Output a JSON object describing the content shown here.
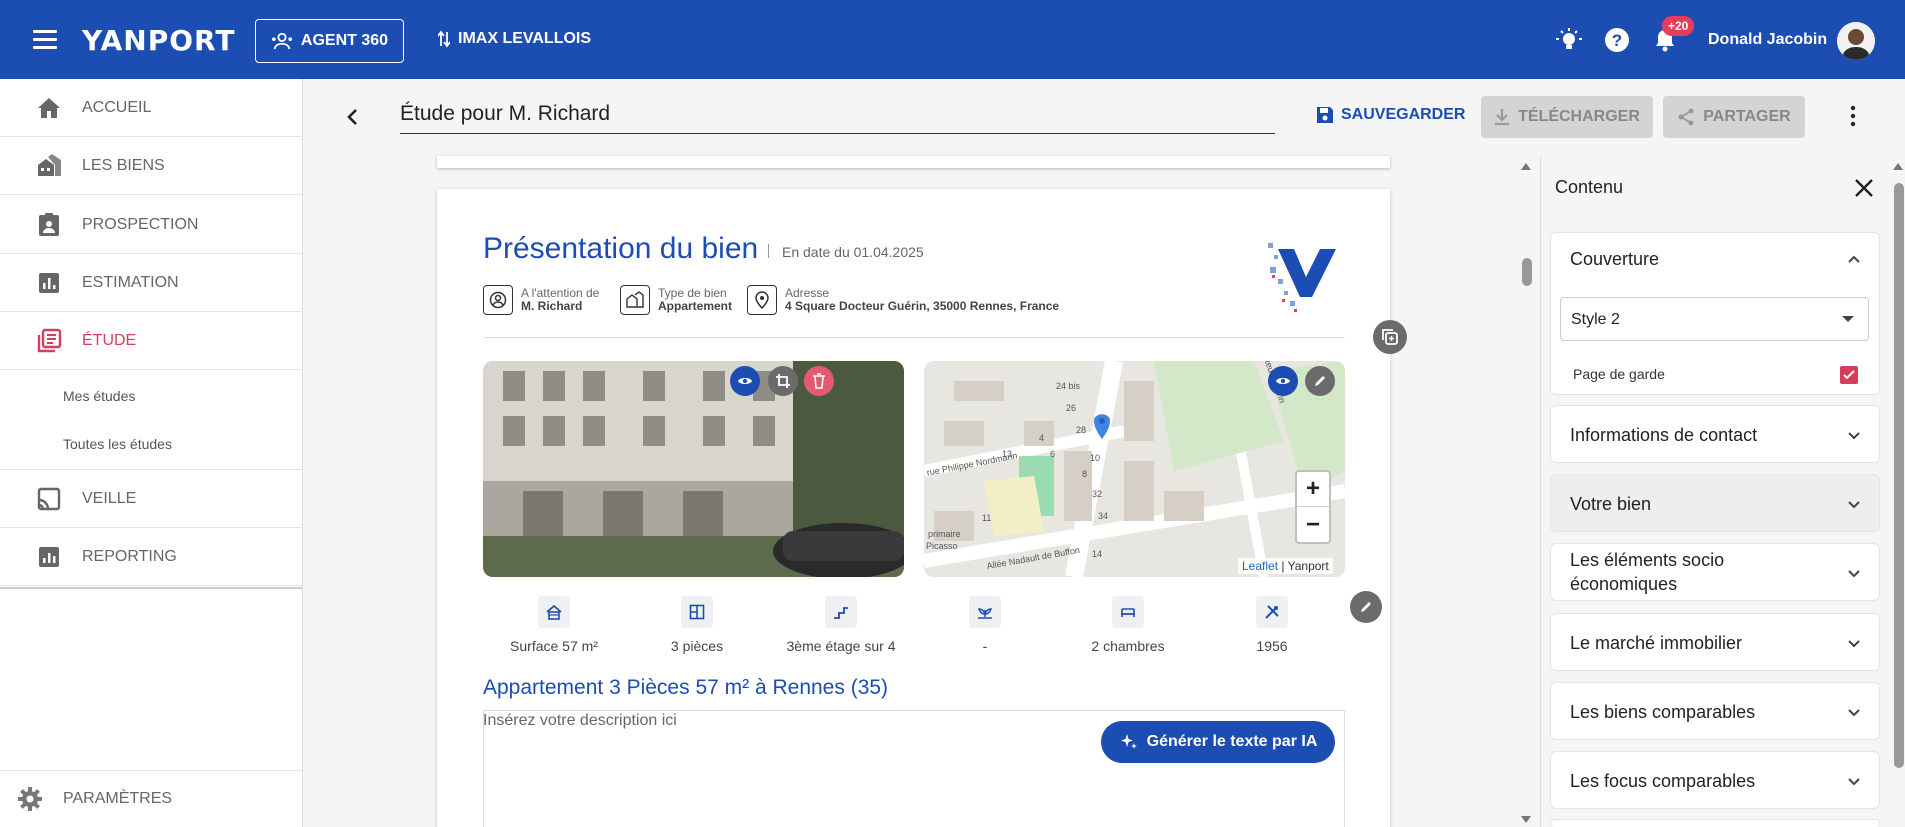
{
  "header": {
    "logo": "YANPORT",
    "agent_button": "AGENT 360",
    "agency": "IMAX LEVALLOIS",
    "notifications_badge": "+20",
    "username": "Donald Jacobin"
  },
  "sidebar": {
    "items": [
      {
        "label": "ACCUEIL"
      },
      {
        "label": "LES BIENS"
      },
      {
        "label": "PROSPECTION"
      },
      {
        "label": "ESTIMATION"
      },
      {
        "label": "ÉTUDE"
      },
      {
        "label": "VEILLE"
      },
      {
        "label": "REPORTING"
      }
    ],
    "subitems": [
      "Mes études",
      "Toutes les études"
    ],
    "settings": "PARAMÈTRES"
  },
  "toolbar": {
    "title": "Étude pour M. Richard",
    "save": "SAUVEGARDER",
    "download": "TÉLÉCHARGER",
    "share": "PARTAGER"
  },
  "page": {
    "title": "Présentation du bien",
    "date": "En date du 01.04.2025",
    "attention_label": "A l'attention de",
    "attention_value": "M. Richard",
    "type_label": "Type de bien",
    "type_value": "Appartement",
    "address_label": "Adresse",
    "address_value": "4 Square Docteur Guérin, 35000 Rennes, France",
    "map_attribution_leaflet": "Leaflet",
    "map_attribution_sep": "|",
    "map_attribution_owner": "Yanport",
    "map_labels": [
      "rue Philippe Nordmann",
      "Allée Nadault de Buffon",
      "primaire",
      "Picasso",
      "Docteur Guérin",
      "24 bis",
      "26",
      "28",
      "4",
      "8",
      "10",
      "32",
      "34",
      "14",
      "11",
      "13",
      "6"
    ],
    "features": [
      "Surface 57 m²",
      "3 pièces",
      "3ème étage sur 4",
      "-",
      "2 chambres",
      "1956"
    ],
    "apartment_title": "Appartement 3 Pièces 57 m² à Rennes (35)",
    "description_placeholder": "Insérez votre description ici",
    "ia_button": "Générer le texte par IA"
  },
  "panel": {
    "title": "Contenu",
    "cover": {
      "label": "Couverture",
      "style_value": "Style 2",
      "cover_page_label": "Page de garde",
      "cover_page_checked": true
    },
    "sections": [
      "Informations de contact",
      "Votre bien",
      "Les éléments socio économiques",
      "Le marché immobilier",
      "Les biens comparables",
      "Les focus comparables"
    ]
  },
  "colors": {
    "brand_blue": "#1c4db3",
    "active_red": "#d63e5c",
    "badge_red": "#e63d5c"
  }
}
